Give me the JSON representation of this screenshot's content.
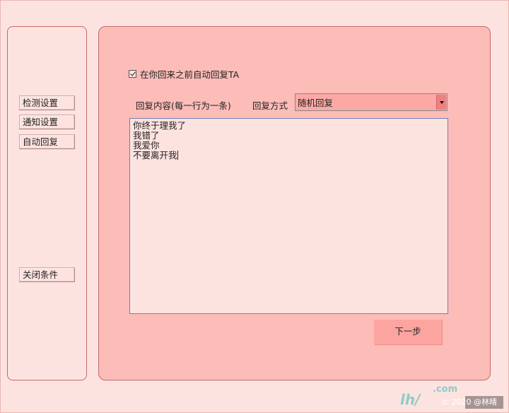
{
  "sidebar": {
    "items": [
      {
        "label": "检测设置"
      },
      {
        "label": "通知设置"
      },
      {
        "label": "自动回复"
      },
      {
        "label": "关闭条件"
      }
    ]
  },
  "main": {
    "auto_reply_checkbox": {
      "label": "在你回来之前自动回复TA",
      "checked": true
    },
    "reply_content_label": "回复内容(每一行为一条)",
    "reply_mode_label": "回复方式",
    "reply_mode_select": {
      "value": "随机回复"
    },
    "reply_text": "你终于理我了\n我错了\n我爱你\n不要离开我",
    "next_button_label": "下一步"
  },
  "colors": {
    "background": "#fde3e0",
    "panel": "#fcbcb8",
    "panel_border": "#c56a6a",
    "select_bg": "#fca9a5",
    "button_bg": "#fca4a0",
    "textarea_border": "#6f82b6"
  },
  "watermark": {
    "text": "© 2020 @林晴"
  }
}
